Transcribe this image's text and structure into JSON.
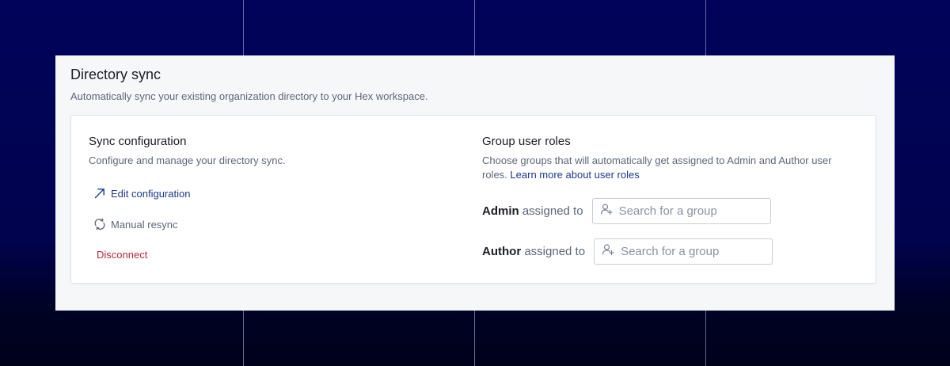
{
  "directory_sync": {
    "title": "Directory sync",
    "subtitle": "Automatically sync your existing organization directory to your Hex workspace."
  },
  "sync_configuration": {
    "title": "Sync configuration",
    "description": "Configure and manage your directory sync.",
    "actions": {
      "edit": {
        "label": "Edit configuration",
        "icon": "arrow-up-right-icon"
      },
      "resync": {
        "label": "Manual resync",
        "icon": "refresh-icon"
      },
      "disconnect": {
        "label": "Disconnect"
      }
    }
  },
  "group_user_roles": {
    "title": "Group user roles",
    "description": "Choose groups that will automatically get assigned to Admin and Author user roles.",
    "learn_more_link": "Learn more about user roles",
    "roles": [
      {
        "role": "Admin",
        "suffix": "assigned to",
        "placeholder": "Search for a group",
        "value": ""
      },
      {
        "role": "Author",
        "suffix": "assigned to",
        "placeholder": "Search for a group",
        "value": ""
      }
    ]
  },
  "colors": {
    "link": "#1d3a8a",
    "danger": "#b3283b",
    "background": "#01035a",
    "panel": "#f6f7f9"
  }
}
